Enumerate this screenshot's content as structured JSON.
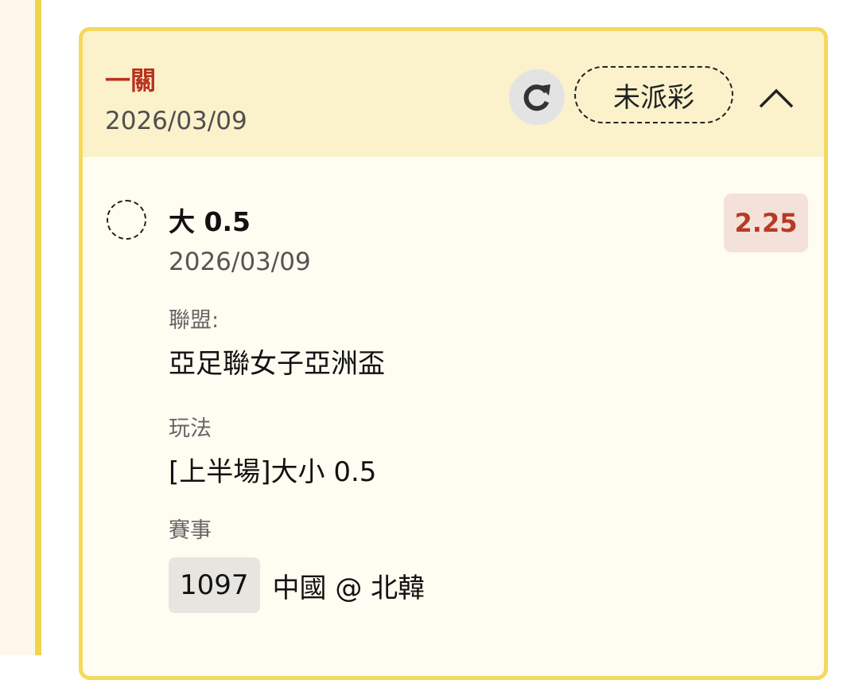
{
  "card": {
    "bet_type": "一關",
    "date": "2026/03/09",
    "status": "未派彩"
  },
  "selection": {
    "name": "大 0.5",
    "date": "2026/03/09",
    "odds": "2.25",
    "league_label": "聯盟:",
    "league_value": "亞足聯女子亞洲盃",
    "play_label": "玩法",
    "play_value": "[上半場]大小 0.5",
    "match_label": "賽事",
    "match_code": "1097",
    "match_teams": "中國 @ 北韓"
  },
  "icons": {
    "refresh": "refresh-icon",
    "collapse": "chevron-up-icon",
    "selection": "dashed-circle-icon"
  },
  "colors": {
    "accent": "#b8321f",
    "header_bg": "#fbf2cc",
    "card_border": "#f4d95c",
    "odds_bg": "#f4e2da"
  }
}
